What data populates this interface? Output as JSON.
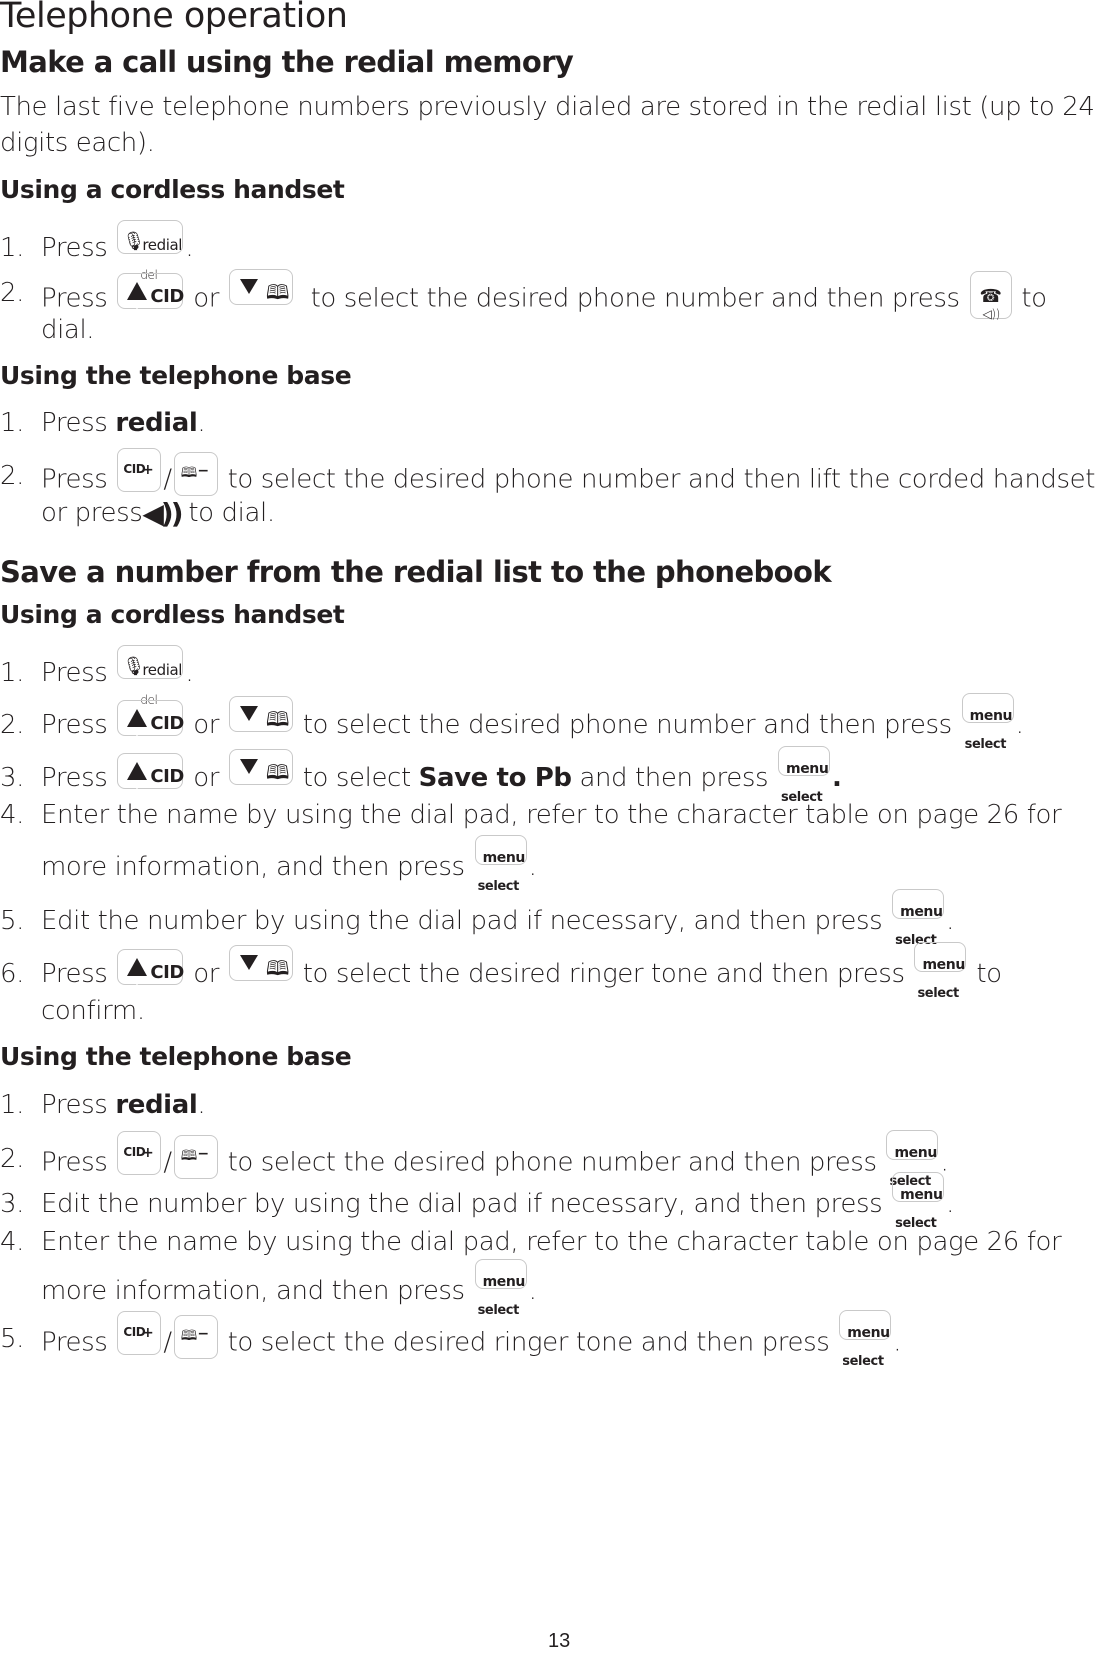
{
  "page": {
    "title": "Telephone operation",
    "page_number": "13"
  },
  "section1": {
    "heading": "Make a call using the redial memory",
    "intro_line1": "The last five telephone numbers previously dialed are stored in the redial list (up to 24",
    "intro_line2": "digits each).",
    "handset": {
      "heading": "Using a cordless handset",
      "steps": [
        {
          "num": "1.",
          "pre": "Press",
          "post": "."
        },
        {
          "num": "2.",
          "pre": "Press",
          "or": "or",
          "mid": "to select the desired phone number and then press",
          "post": "to",
          "cont": "dial."
        }
      ]
    },
    "base": {
      "heading": "Using the telephone base",
      "steps": [
        {
          "num": "1.",
          "pre": "Press",
          "bold": "redial",
          "post": "."
        },
        {
          "num": "2.",
          "pre": "Press",
          "slash": "/",
          "mid": "to select the desired phone number and then lift the corded handset",
          "cont_pre": "or press",
          "cont_post": "to dial."
        }
      ]
    }
  },
  "section2": {
    "heading": "Save a number from the redial list to the phonebook",
    "handset": {
      "heading": "Using a cordless handset",
      "steps": [
        {
          "num": "1.",
          "pre": "Press",
          "post": "."
        },
        {
          "num": "2.",
          "pre": "Press",
          "or": "or",
          "mid": "to select the desired phone number and then press",
          "post": "."
        },
        {
          "num": "3.",
          "pre": "Press",
          "or": "or",
          "mid": "to select",
          "bold": "Save to Pb",
          "mid2": "and then press",
          "post": "."
        },
        {
          "num": "4.",
          "line1": "Enter the name by using the dial pad, refer to the character table on page 26 for",
          "line2": "more information, and then press",
          "post": "."
        },
        {
          "num": "5.",
          "line1": "Edit the number by using the dial pad if necessary, and then press",
          "post": "."
        },
        {
          "num": "6.",
          "pre": "Press",
          "or": "or",
          "mid": "to select the desired ringer tone and then press",
          "post": "to",
          "cont": "confirm."
        }
      ]
    },
    "base": {
      "heading": "Using the telephone base",
      "steps": [
        {
          "num": "1.",
          "pre": "Press",
          "bold": "redial",
          "post": "."
        },
        {
          "num": "2.",
          "pre": "Press",
          "slash": "/",
          "mid": "to select the desired phone number and then press",
          "post": "."
        },
        {
          "num": "3.",
          "line1": "Edit the number by using the dial pad if necessary, and then press",
          "post": "."
        },
        {
          "num": "4.",
          "line1": "Enter the name by using the dial pad, refer to the character table on page 26 for",
          "line2": "more information, and then press",
          "post": "."
        },
        {
          "num": "5.",
          "pre": "Press",
          "slash": "/",
          "mid": "to select the desired ringer tone and then press",
          "post": "."
        }
      ]
    }
  },
  "keys": {
    "redial": {
      "label": "redial",
      "sub": "del",
      "icon": "mute-mic-icon"
    },
    "cid": {
      "label": "CID",
      "icon": "up-plus-icon"
    },
    "pb": {
      "icon": "down-phonebook-icon",
      "glyph": "🕮"
    },
    "speaker": {
      "icon": "handset-speaker-icon",
      "hs": "☎",
      "sp": "◁))"
    },
    "base_cid": {
      "top": "CID",
      "bottom": "+"
    },
    "base_pb": {
      "top": "−",
      "bottom": "🕮"
    },
    "menu": {
      "top": "menu",
      "bottom": "select"
    },
    "speaker_inline": "◀))"
  }
}
